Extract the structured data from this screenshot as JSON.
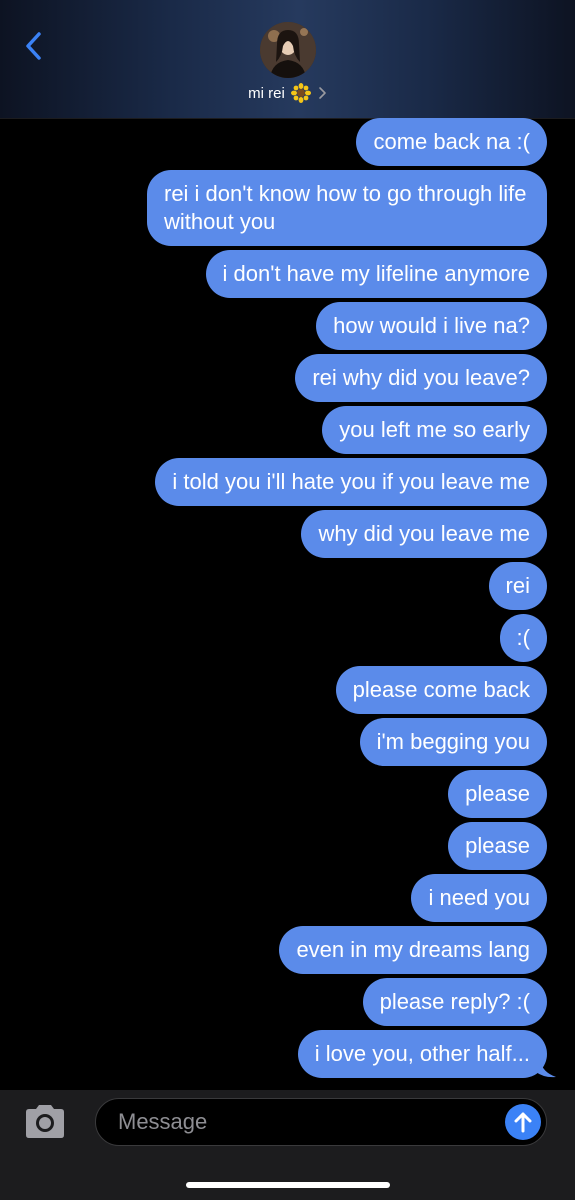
{
  "header": {
    "contact_name": "mi rei",
    "emoji_icon": "sunflower-icon",
    "back_icon": "chevron-left-icon",
    "accent_color": "#3b82f6"
  },
  "messages": [
    "come back na :(",
    "rei i don't know how to go through life without you",
    "i don't have my lifeline anymore",
    "how would i live na?",
    "rei why did you leave?",
    "you left me so early",
    "i told you i'll hate you if you leave me",
    "why did you leave me",
    "rei",
    ":(",
    "please come back",
    "i'm begging you",
    "please",
    "please",
    "i need you",
    "even in my dreams lang",
    "please reply? :(",
    "i love you, other half..."
  ],
  "bubble_color": "#5b8bea",
  "composer": {
    "placeholder": "Message",
    "camera_icon": "camera-icon",
    "send_icon": "arrow-up-icon"
  }
}
